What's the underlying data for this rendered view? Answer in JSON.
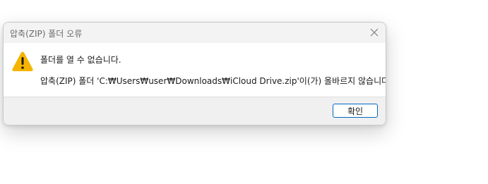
{
  "dialog": {
    "title": "압축(ZIP) 폴더 오류",
    "close_icon": "close-icon",
    "warning_icon": "warning-icon",
    "message_main": "폴더를 열 수 없습니다.",
    "message_detail": "압축(ZIP) 폴더 'C:₩Users₩user₩Downloads₩iCloud Drive.zip'이(가) 올바르지 않습니다.",
    "ok_label": "확인"
  },
  "colors": {
    "titlebar_bg": "#f3f3f3",
    "footer_bg": "#f0f0f0",
    "accent": "#0067c0",
    "warning_yellow": "#f5b400"
  }
}
